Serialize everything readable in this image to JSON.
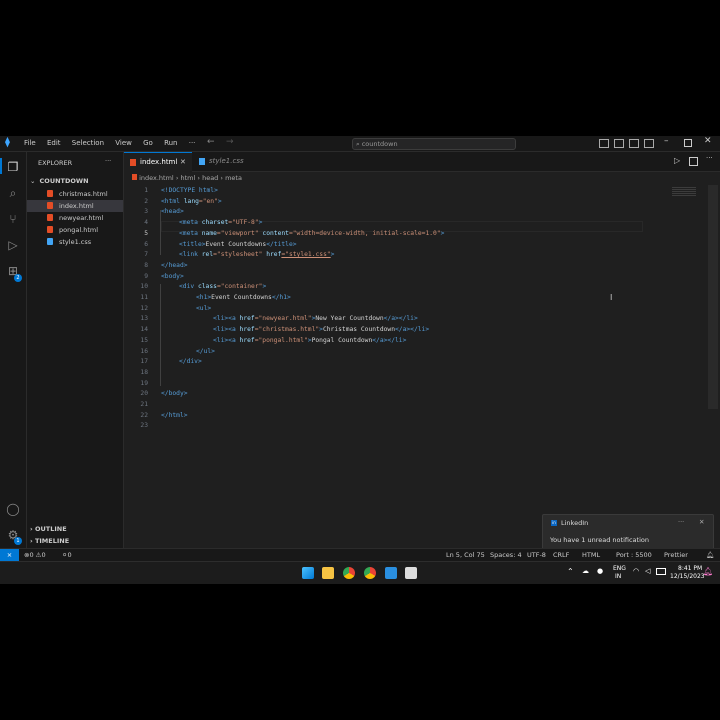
{
  "titlebar": {
    "menus": [
      "File",
      "Edit",
      "Selection",
      "View",
      "Go",
      "Run",
      "···"
    ],
    "search_text": "countdown"
  },
  "sidebar": {
    "title": "EXPLORER",
    "more": "···",
    "folder": "COUNTDOWN",
    "files": [
      "christmas.html",
      "index.html",
      "newyear.html",
      "pongal.html",
      "style1.css"
    ],
    "outline": "OUTLINE",
    "timeline": "TIMELINE"
  },
  "tabs": [
    {
      "label": "index.html"
    },
    {
      "label": "style1.css"
    }
  ],
  "breadcrumbs": [
    "index.html",
    "html",
    "head",
    "meta"
  ],
  "activity_badge": "2",
  "account_badge": "1",
  "status": {
    "left": "⊗0 ⚠0",
    "ports": "⚪0",
    "position": "Ln 5, Col 75",
    "spaces": "Spaces: 4",
    "encoding": "UTF-8",
    "eol": "CRLF",
    "lang": "HTML",
    "golive": "Port : 5500",
    "prettier": "Prettier"
  },
  "taskbar": {
    "lang1": "ENG",
    "lang2": "IN",
    "time": "8:41 PM",
    "date": "12/15/2023"
  },
  "notification": {
    "app": "LinkedIn",
    "message": "You have 1 unread notification"
  },
  "code_lines": [
    "1",
    "2",
    "3",
    "4",
    "5",
    "6",
    "7",
    "8",
    "9",
    "10",
    "11",
    "12",
    "13",
    "14",
    "15",
    "16",
    "17",
    "18",
    "19",
    "20",
    "21",
    "22",
    "23"
  ],
  "code": {
    "l1": "<!DOCTYPE html>",
    "l2a": "<html ",
    "l2b": "lang",
    "l2c": "=\"en\"",
    "l2d": ">",
    "l3": "<head>",
    "l4a": "<meta ",
    "l4b": "charset",
    "l4c": "=\"UTF-8\"",
    "l4d": ">",
    "l5a": "<meta ",
    "l5b": "name",
    "l5c": "=\"viewport\" ",
    "l5d": "content",
    "l5e": "=\"width=device-width, initial-scale=1.0\"",
    "l5f": ">",
    "l6a": "<title>",
    "l6b": "Event Countdowns",
    "l6c": "</title>",
    "l7a": "<link ",
    "l7b": "rel",
    "l7c": "=\"stylesheet\" ",
    "l7d": "href",
    "l7e": "=\"style1.css\"",
    "l7f": ">",
    "l8": "</head>",
    "l9": "<body>",
    "l10a": "<div ",
    "l10b": "class",
    "l10c": "=\"container\"",
    "l10d": ">",
    "l11a": "<h1>",
    "l11b": "Event Countdowns",
    "l11c": "</h1>",
    "l12": "<ul>",
    "l13a": "<li><a ",
    "l13b": "href",
    "l13c": "=\"newyear.html\"",
    "l13d": ">",
    "l13e": "New Year Countdown",
    "l13f": "</a></li>",
    "l14a": "<li><a ",
    "l14b": "href",
    "l14c": "=\"christmas.html\"",
    "l14d": ">",
    "l14e": "Christmas Countdown",
    "l14f": "</a></li>",
    "l15a": "<li><a ",
    "l15b": "href",
    "l15c": "=\"pongal.html\"",
    "l15d": ">",
    "l15e": "Pongal Countdown",
    "l15f": "</a></li>",
    "l16": "</ul>",
    "l17": "</div>",
    "l20": "</body>",
    "l22": "</html>"
  },
  "colors": {
    "accent": "#0078d4",
    "tag": "#569cd6",
    "attr": "#9cdcfe",
    "string": "#ce9178"
  }
}
